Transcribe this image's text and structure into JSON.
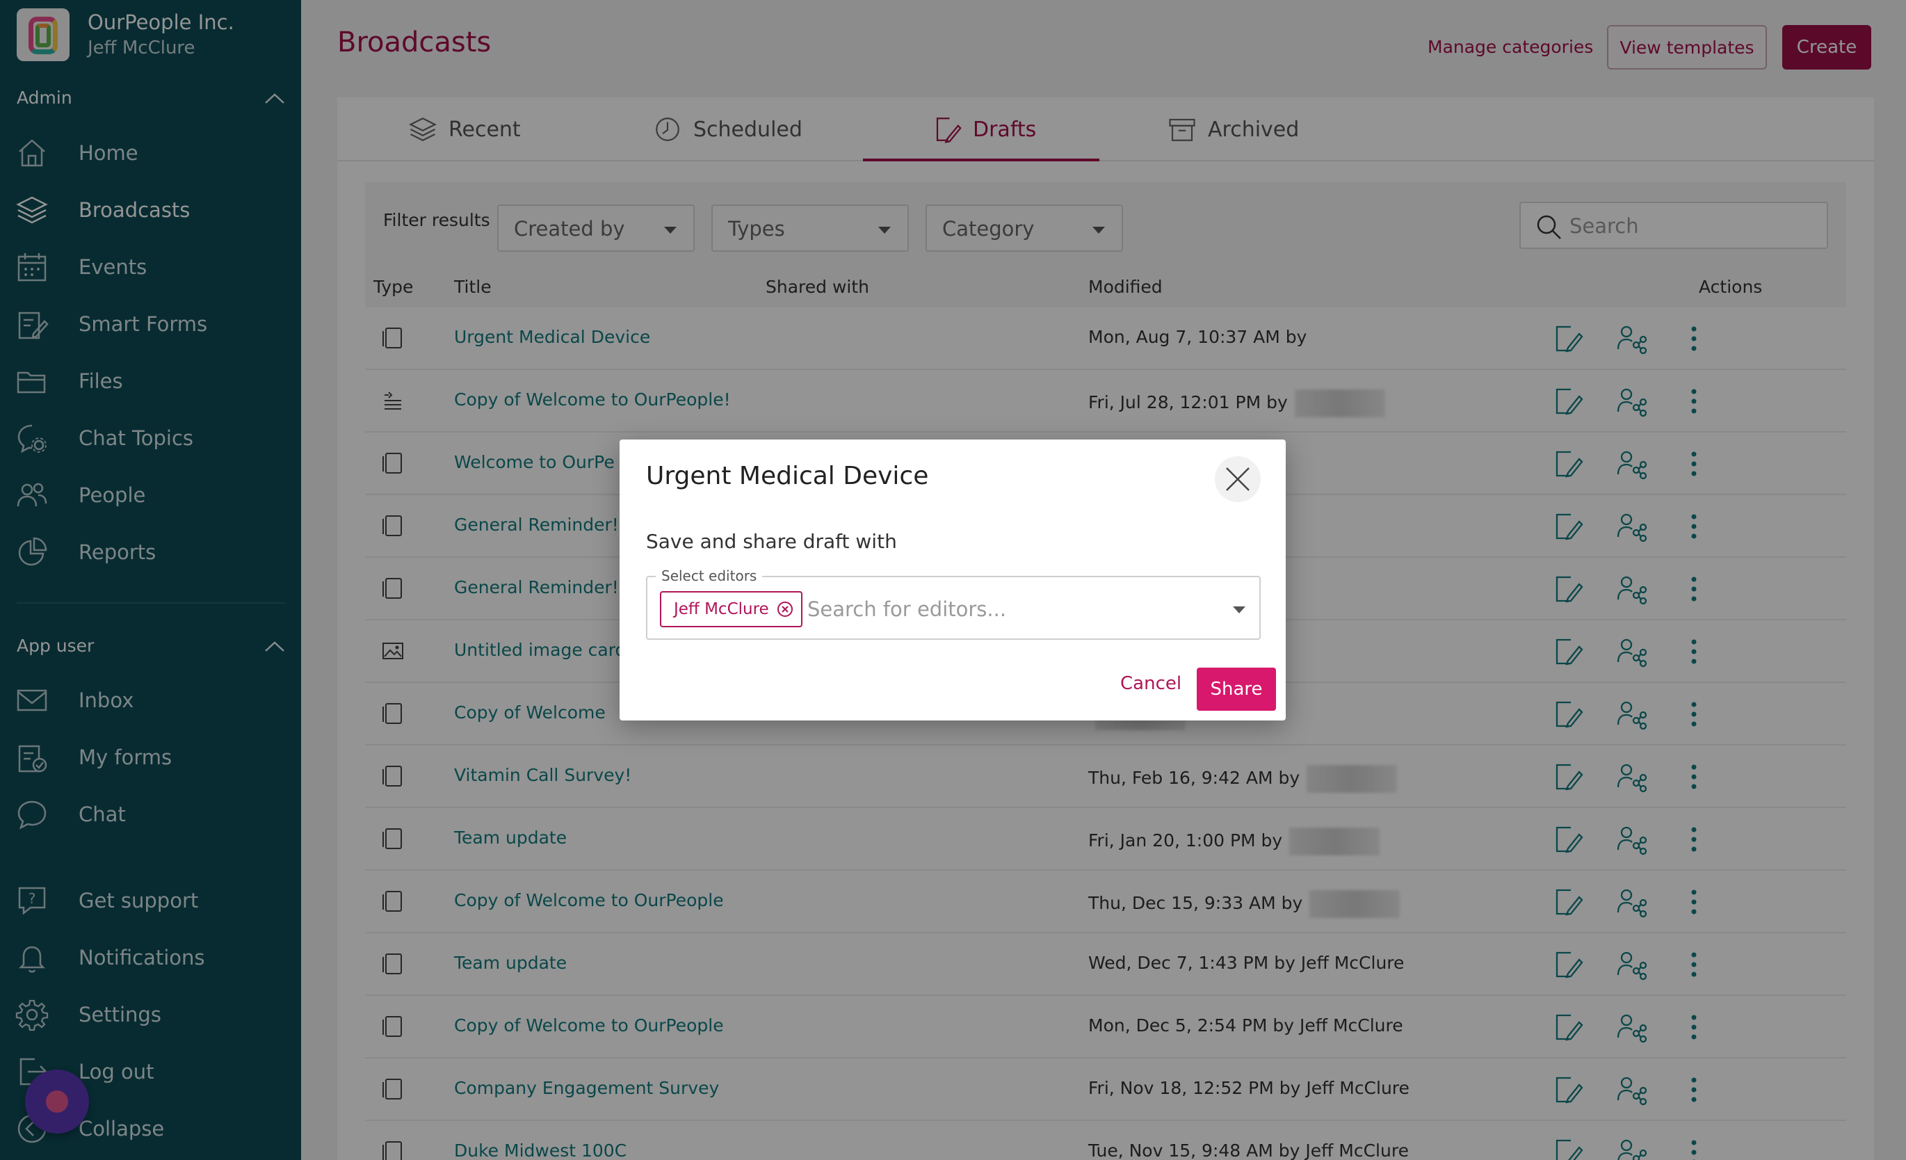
{
  "org": {
    "name": "OurPeople Inc.",
    "user": "Jeff McClure"
  },
  "sidebar": {
    "admin_label": "Admin",
    "admin_items": [
      {
        "label": "Home",
        "icon": "home-icon"
      },
      {
        "label": "Broadcasts",
        "icon": "layers-icon",
        "active": true
      },
      {
        "label": "Events",
        "icon": "calendar-icon"
      },
      {
        "label": "Smart Forms",
        "icon": "form-icon"
      },
      {
        "label": "Files",
        "icon": "folder-icon"
      },
      {
        "label": "Chat Topics",
        "icon": "chat-topics-icon"
      },
      {
        "label": "People",
        "icon": "people-icon"
      },
      {
        "label": "Reports",
        "icon": "pie-chart-icon"
      }
    ],
    "app_user_label": "App user",
    "app_user_items": [
      {
        "label": "Inbox",
        "icon": "mail-icon"
      },
      {
        "label": "My forms",
        "icon": "my-forms-icon"
      },
      {
        "label": "Chat",
        "icon": "chat-bubble-icon"
      }
    ],
    "bottom_items": [
      {
        "label": "Get support",
        "icon": "help-icon"
      },
      {
        "label": "Notifications",
        "icon": "bell-icon"
      },
      {
        "label": "Settings",
        "icon": "gear-icon"
      },
      {
        "label": "Log out",
        "icon": "logout-icon"
      },
      {
        "label": "Collapse",
        "icon": "collapse-icon"
      }
    ]
  },
  "header": {
    "title": "Broadcasts",
    "manage_categories": "Manage categories",
    "view_templates": "View templates",
    "create": "Create"
  },
  "tabs": [
    {
      "label": "Recent",
      "icon": "layers-icon"
    },
    {
      "label": "Scheduled",
      "icon": "clock-icon"
    },
    {
      "label": "Drafts",
      "icon": "edit-document-icon",
      "active": true
    },
    {
      "label": "Archived",
      "icon": "archive-icon"
    }
  ],
  "filters": {
    "label": "Filter results",
    "created_by": "Created by",
    "types": "Types",
    "category": "Category",
    "search_placeholder": "Search"
  },
  "table": {
    "columns": {
      "type": "Type",
      "title": "Title",
      "shared_with": "Shared with",
      "modified": "Modified",
      "actions": "Actions"
    },
    "rows": [
      {
        "type": "card-icon",
        "title": "Urgent Medical Device",
        "modified": "Mon, Aug 7, 10:37 AM by",
        "redacted": false
      },
      {
        "type": "list-icon",
        "title": "Copy of Welcome to OurPeople!",
        "modified": "Fri, Jul 28, 12:01 PM by",
        "redacted": true
      },
      {
        "type": "card-icon",
        "title": "Welcome to OurPe",
        "modified": "",
        "redacted": true
      },
      {
        "type": "card-icon",
        "title": "General Reminder!",
        "modified": "",
        "redacted": true
      },
      {
        "type": "card-icon",
        "title": "General Reminder!",
        "modified": "",
        "redacted": true
      },
      {
        "type": "image-icon",
        "title": "Untitled image card",
        "modified": "",
        "redacted": true
      },
      {
        "type": "card-icon",
        "title": "Copy of Welcome",
        "modified": "",
        "redacted": true
      },
      {
        "type": "card-icon",
        "title": "Vitamin Call Survey!",
        "modified": "Thu, Feb 16, 9:42 AM by",
        "redacted": true
      },
      {
        "type": "card-icon",
        "title": "Team update",
        "modified": "Fri, Jan 20, 1:00 PM by",
        "redacted": true
      },
      {
        "type": "card-icon",
        "title": "Copy of Welcome to OurPeople",
        "modified": "Thu, Dec 15, 9:33 AM by",
        "redacted": true
      },
      {
        "type": "card-icon",
        "title": "Team update",
        "modified": "Wed, Dec 7, 1:43 PM by Jeff McClure",
        "redacted": false
      },
      {
        "type": "card-icon",
        "title": "Copy of Welcome to OurPeople",
        "modified": "Mon, Dec 5, 2:54 PM by Jeff McClure",
        "redacted": false
      },
      {
        "type": "card-icon",
        "title": "Company Engagement Survey",
        "modified": "Fri, Nov 18, 12:52 PM by Jeff McClure",
        "redacted": false
      },
      {
        "type": "card-icon",
        "title": "Duke Midwest 100C",
        "modified": "Tue, Nov 15, 9:48 AM by Jeff McClure",
        "redacted": false
      }
    ]
  },
  "modal": {
    "title": "Urgent Medical Device",
    "subtitle": "Save and share draft with",
    "field_legend": "Select editors",
    "chip": "Jeff McClure",
    "search_placeholder": "Search for editors...",
    "cancel": "Cancel",
    "share": "Share"
  },
  "colors": {
    "sidebar": "#0d4a55",
    "accent": "#a3114a",
    "share": "#d8186c",
    "link": "#147a7f"
  }
}
